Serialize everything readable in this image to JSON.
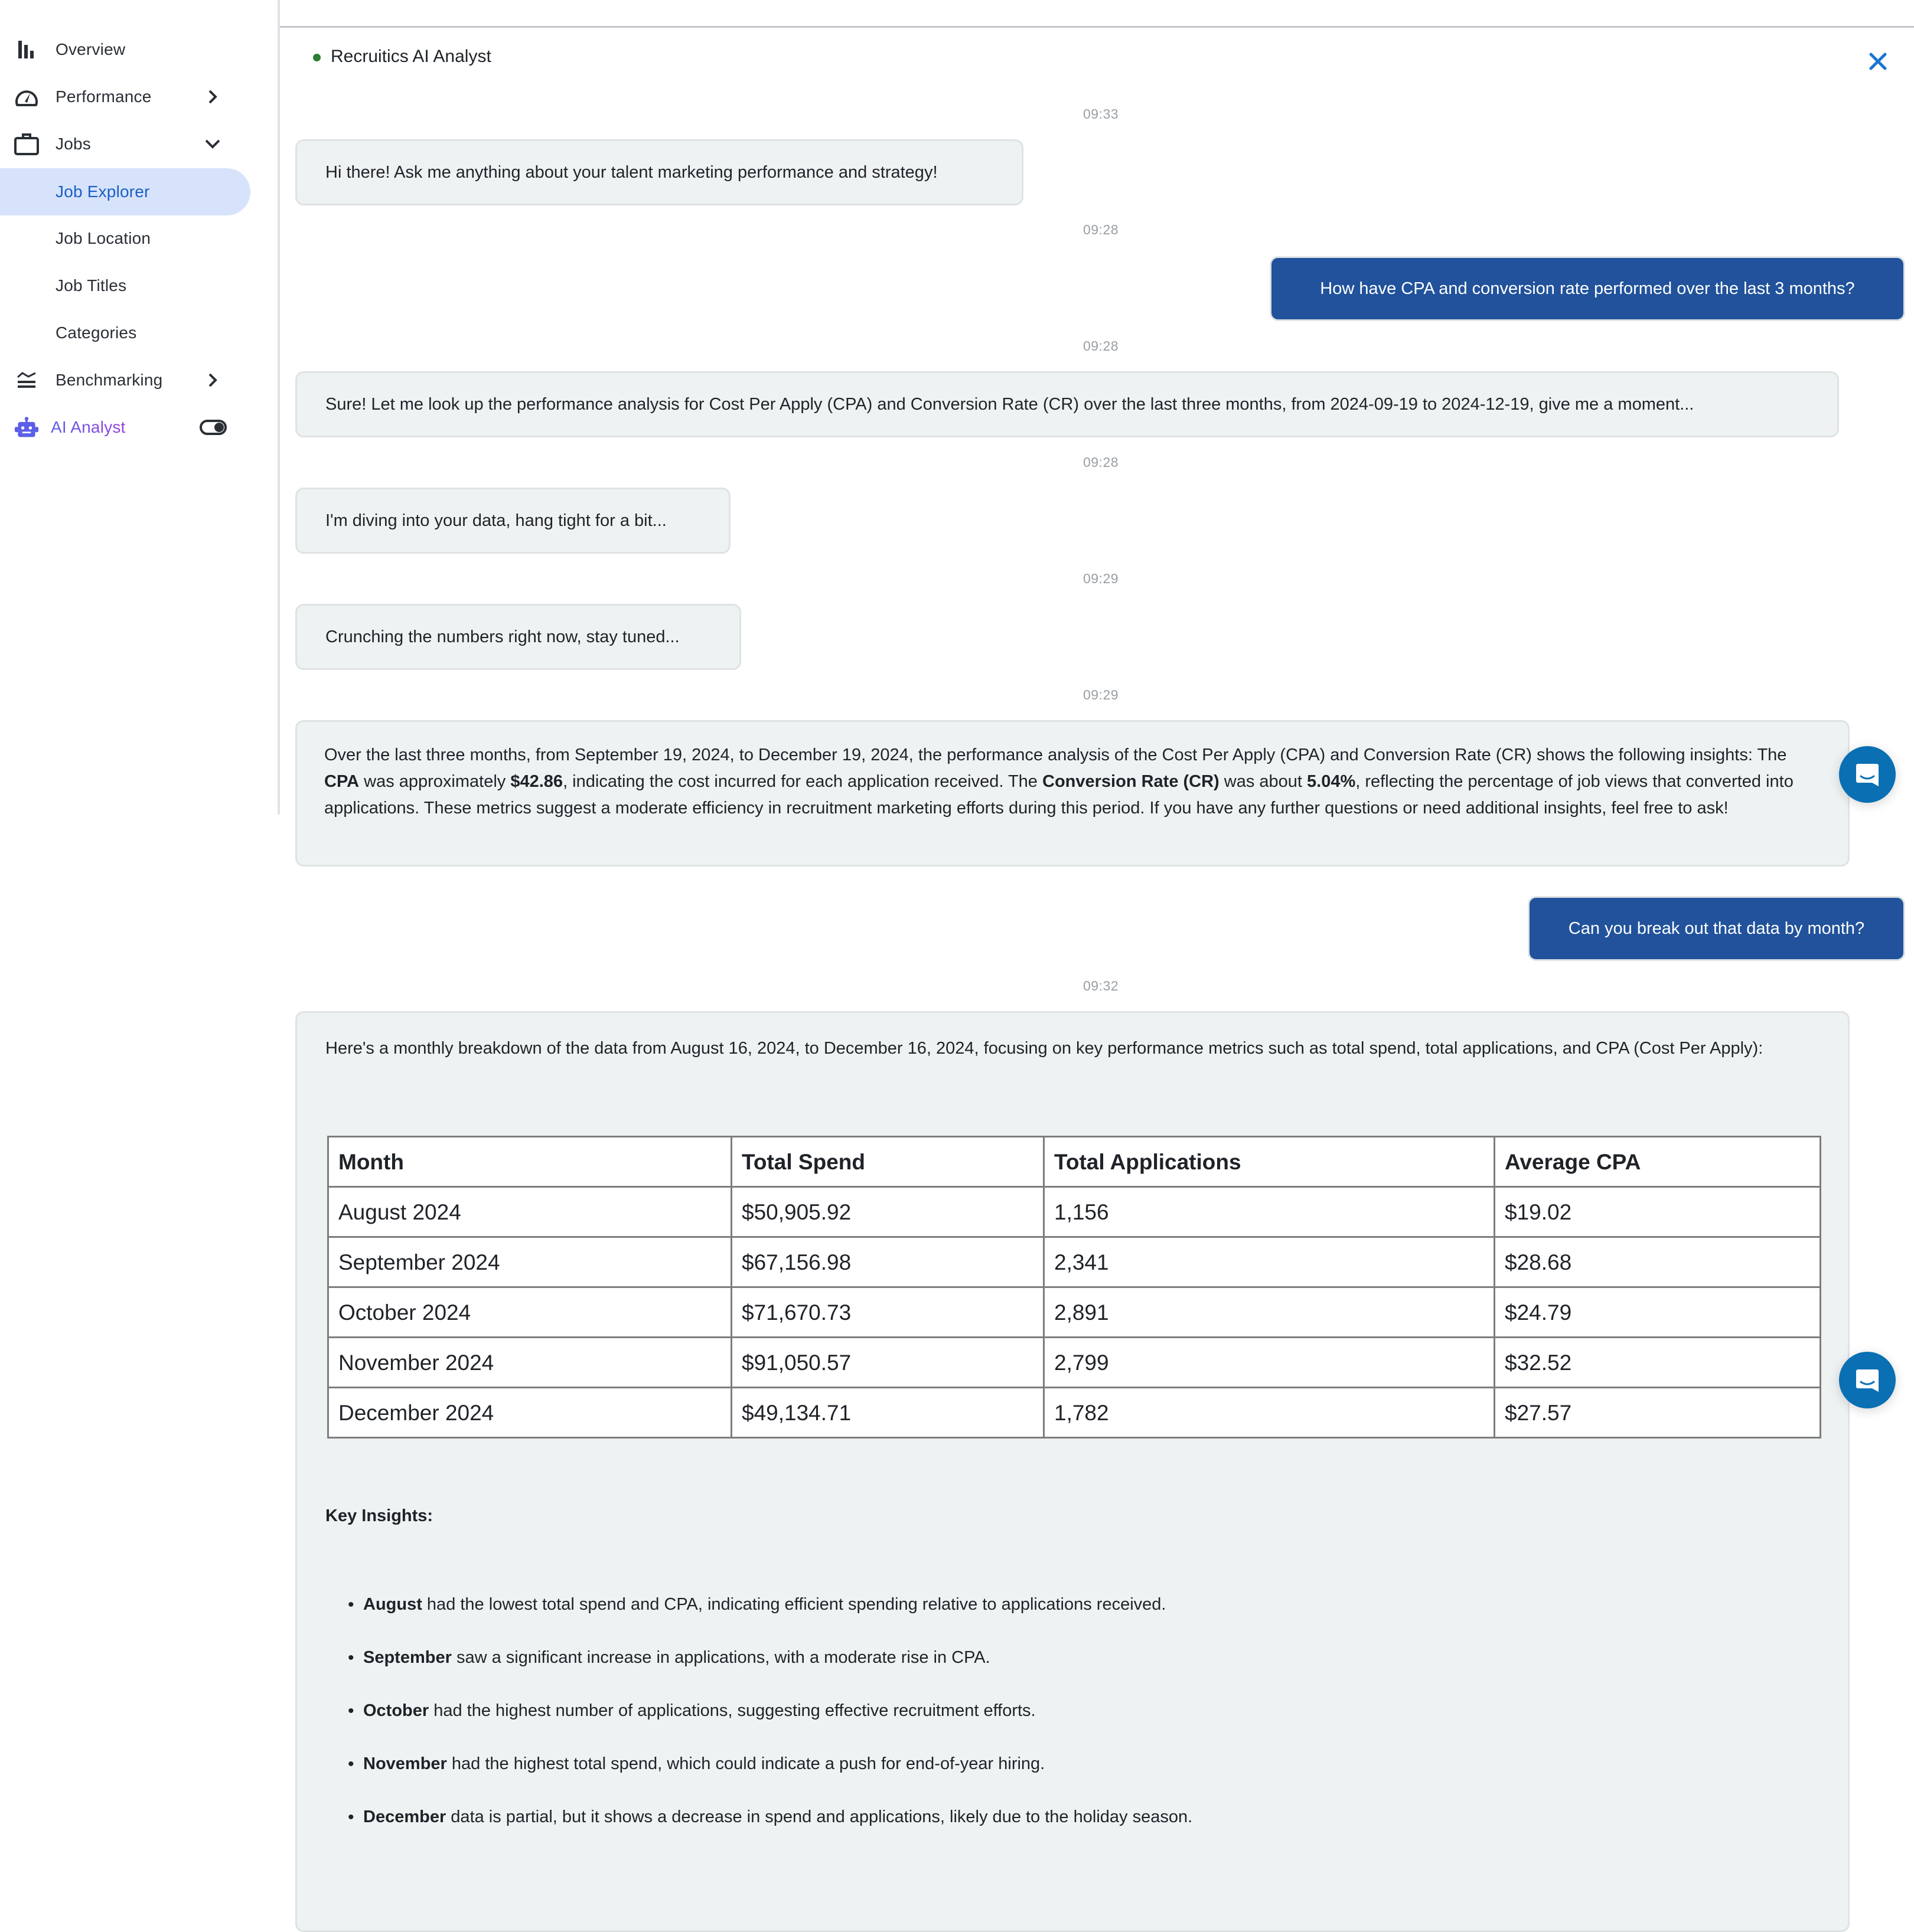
{
  "sidebar": {
    "items": [
      {
        "label": "Overview",
        "icon": "bar-chart-icon"
      },
      {
        "label": "Performance",
        "icon": "speedometer-icon",
        "chevron": "chevron-right-icon"
      },
      {
        "label": "Jobs",
        "icon": "briefcase-icon",
        "chevron": "chevron-down-icon",
        "expanded": true
      },
      {
        "label": "Job Explorer",
        "active": true
      },
      {
        "label": "Job Location"
      },
      {
        "label": "Job Titles"
      },
      {
        "label": "Categories"
      },
      {
        "label": "Benchmarking",
        "icon": "benchmark-icon",
        "chevron": "chevron-right-icon"
      },
      {
        "label": "AI Analyst",
        "icon": "robot-icon",
        "toggle": "on"
      }
    ]
  },
  "chat": {
    "title": "Recruitics AI Analyst",
    "status": "online",
    "colors": {
      "user_bubble": "#21529b",
      "bot_bubble": "#eff2f3",
      "status_dot": "#2e7d32",
      "close_icon": "#1976d2",
      "fab": "#0a6fb3"
    },
    "timestamps": [
      "09:33",
      "09:28",
      "09:28",
      "09:28",
      "09:29",
      "09:29",
      "09:32"
    ],
    "messages": [
      {
        "role": "bot",
        "text": "Hi there! Ask me anything about your talent marketing performance and strategy!"
      },
      {
        "role": "user",
        "text": "How have CPA and conversion rate performed over the last 3 months?"
      },
      {
        "role": "bot",
        "text": "Sure! Let me look up the performance analysis for Cost Per Apply (CPA) and Conversion Rate (CR) over the last three months, from 2024-09-19 to 2024-12-19, give me a moment..."
      },
      {
        "role": "bot",
        "text": "I'm diving into your data, hang tight for a bit..."
      },
      {
        "role": "bot",
        "text": "Crunching the numbers right now, stay tuned..."
      },
      {
        "role": "bot",
        "parts": [
          {
            "t": "Over the last three months, from September 19, 2024, to December 19, 2024, the performance analysis of the Cost Per Apply (CPA) and Conversion Rate (CR) shows the following insights: The "
          },
          {
            "t": "CPA",
            "b": true
          },
          {
            "t": " was approximately "
          },
          {
            "t": "$42.86",
            "b": true
          },
          {
            "t": ", indicating the cost incurred for each application received. The "
          },
          {
            "t": "Conversion Rate (CR)",
            "b": true
          },
          {
            "t": " was about "
          },
          {
            "t": "5.04%",
            "b": true
          },
          {
            "t": ", reflecting the percentage of job views that converted into applications. These metrics suggest a moderate efficiency in recruitment marketing efforts during this period. If you have any further questions or need additional insights, feel free to ask!"
          }
        ]
      },
      {
        "role": "user",
        "text": "Can you break out that data by month?"
      },
      {
        "role": "bot",
        "intro": "Here's a monthly breakdown of the data from August 16, 2024, to December 16, 2024, focusing on key performance metrics such as total spend, total applications, and CPA (Cost Per Apply):"
      }
    ],
    "table": {
      "headers": [
        "Month",
        "Total Spend",
        "Total Applications",
        "Average CPA"
      ],
      "rows": [
        [
          "August 2024",
          "$50,905.92",
          "1,156",
          "$19.02"
        ],
        [
          "September 2024",
          "$67,156.98",
          "2,341",
          "$28.68"
        ],
        [
          "October 2024",
          "$71,670.73",
          "2,891",
          "$24.79"
        ],
        [
          "November 2024",
          "$91,050.57",
          "2,799",
          "$32.52"
        ],
        [
          "December 2024",
          "$49,134.71",
          "1,782",
          "$27.57"
        ]
      ]
    },
    "insights_title": "Key Insights:",
    "insights": [
      {
        "bold": "August",
        "rest": " had the lowest total spend and CPA, indicating efficient spending relative to applications received."
      },
      {
        "bold": "September",
        "rest": " saw a significant increase in applications, with a moderate rise in CPA."
      },
      {
        "bold": "October",
        "rest": " had the highest number of applications, suggesting effective recruitment efforts."
      },
      {
        "bold": "November",
        "rest": " had the highest total spend, which could indicate a push for end-of-year hiring."
      },
      {
        "bold": "December",
        "rest": " data is partial, but it shows a decrease in spend and applications, likely due to the holiday season."
      }
    ]
  }
}
